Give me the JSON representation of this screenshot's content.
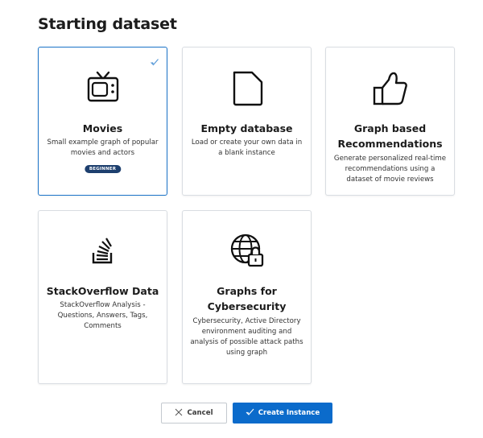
{
  "heading": "Starting dataset",
  "cards": [
    {
      "name": "Movies",
      "desc": "Small example graph of popular movies and actors",
      "badge": "BEGINNER",
      "icon": "tv-icon",
      "selected": true
    },
    {
      "name": "Empty database",
      "desc": "Load or create your own data in a blank instance",
      "icon": "blank-document-icon",
      "selected": false
    },
    {
      "name": "Graph based Recommendations",
      "desc": "Generate personalized real-time recommendations using a dataset of movie reviews",
      "icon": "thumbs-up-icon",
      "selected": false
    },
    {
      "name": "StackOverflow Data",
      "desc": "StackOverflow Analysis - Questions, Answers, Tags, Comments",
      "icon": "stackoverflow-icon",
      "selected": false
    },
    {
      "name": "Graphs for Cybersecurity",
      "desc": "Cybersecurity, Active Directory environment auditing and analysis of possible attack paths using graph",
      "icon": "globe-lock-icon",
      "selected": false
    }
  ],
  "buttons": {
    "cancel": "Cancel",
    "create": "Create Instance"
  },
  "colors": {
    "accent": "#0b6bcb",
    "badge": "#1d3f6e",
    "card_border": "#d9dde2"
  }
}
